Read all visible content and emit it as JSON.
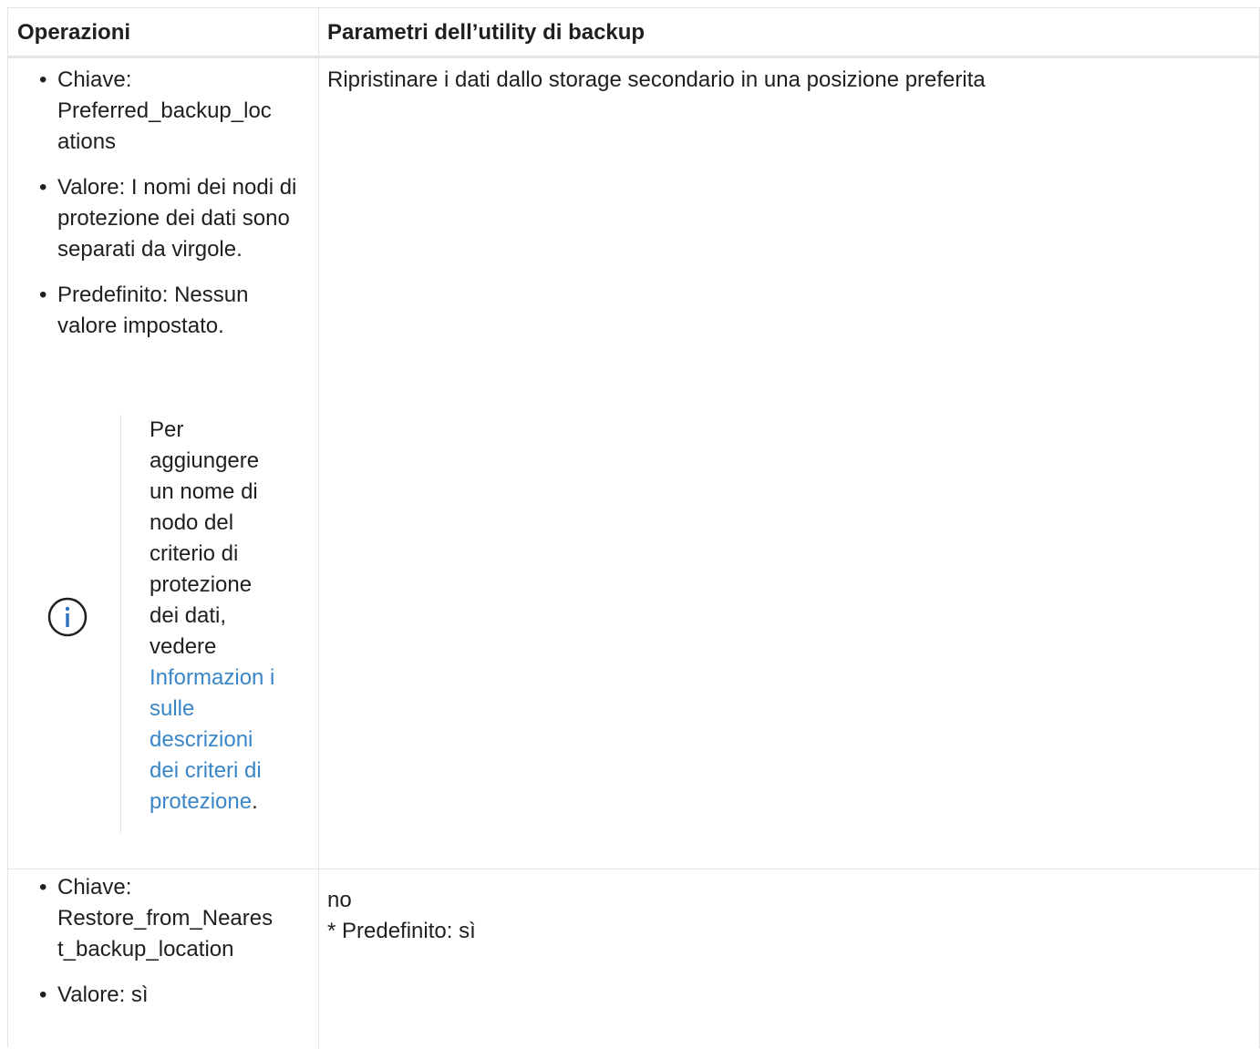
{
  "table": {
    "headers": [
      "Operazioni",
      "Parametri dell’utility di backup"
    ],
    "rows": [
      {
        "operations": [
          "Chiave: Preferred_backup_loc ations",
          "Valore: I nomi dei nodi di protezione dei dati sono separati da virgole.",
          "Predefinito: Nessun valore impostato."
        ],
        "note": {
          "icon": "info-icon",
          "text_before": "Per aggiungere un nome di nodo del criterio di protezione dei dati, vedere ",
          "link_text": "Informazion i sulle descrizioni dei criteri di protezione",
          "text_after": "."
        },
        "parameter": "Ripristinare i dati dallo storage secondario in una posizione preferita"
      },
      {
        "operations": [
          "Chiave: Restore_from_Neares t_backup_location",
          "Valore: sì"
        ],
        "parameter_lines": [
          "no",
          "* Predefinito: sì"
        ]
      }
    ]
  },
  "colors": {
    "link": "#3a86c8",
    "border": "#e3e3e3",
    "text": "#1f1f1f"
  }
}
